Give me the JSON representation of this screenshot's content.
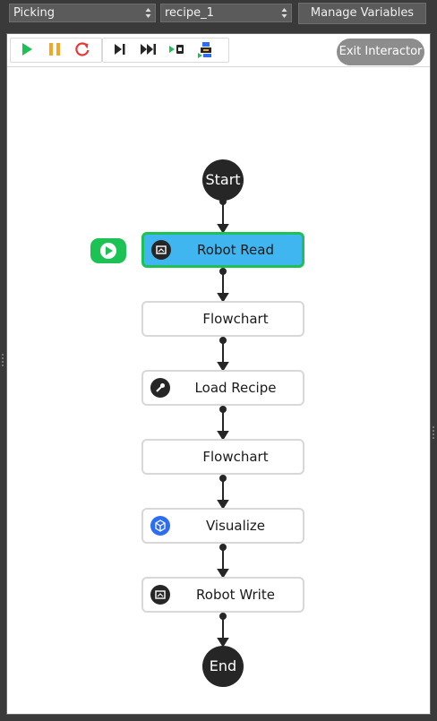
{
  "topbar": {
    "app_select": {
      "value": "Picking"
    },
    "recipe_select": {
      "value": "recipe_1"
    },
    "manage_variables_label": "Manage Variables"
  },
  "toolbar": {
    "buttons": [
      {
        "name": "run-icon",
        "color": "#1dc255"
      },
      {
        "name": "pause-icon",
        "color": "#f5a623"
      },
      {
        "name": "restart-icon",
        "color": "#e53935"
      },
      {
        "name": "step-forward-icon",
        "color": "#262626"
      },
      {
        "name": "fast-forward-icon",
        "color": "#262626"
      },
      {
        "name": "step-into-icon",
        "color": "#1dc255"
      },
      {
        "name": "debug-robot-icon",
        "color": "#2d6df5"
      }
    ],
    "exit_interactor_label": "Exit Interactor"
  },
  "flow": {
    "start_label": "Start",
    "end_label": "End",
    "nodes": [
      {
        "label": "Robot Read",
        "icon": "robot-read-icon",
        "active": true
      },
      {
        "label": "Flowchart",
        "icon": "",
        "active": false
      },
      {
        "label": "Load Recipe",
        "icon": "wrench-icon",
        "active": false
      },
      {
        "label": "Flowchart",
        "icon": "",
        "active": false
      },
      {
        "label": "Visualize",
        "icon": "cube-icon",
        "active": false
      },
      {
        "label": "Robot Write",
        "icon": "robot-write-icon",
        "active": false
      }
    ]
  },
  "colors": {
    "accent_active": "#3fb6f0",
    "active_border": "#1dc255",
    "node_border": "#d8d8d8",
    "terminal_node": "#262626"
  }
}
